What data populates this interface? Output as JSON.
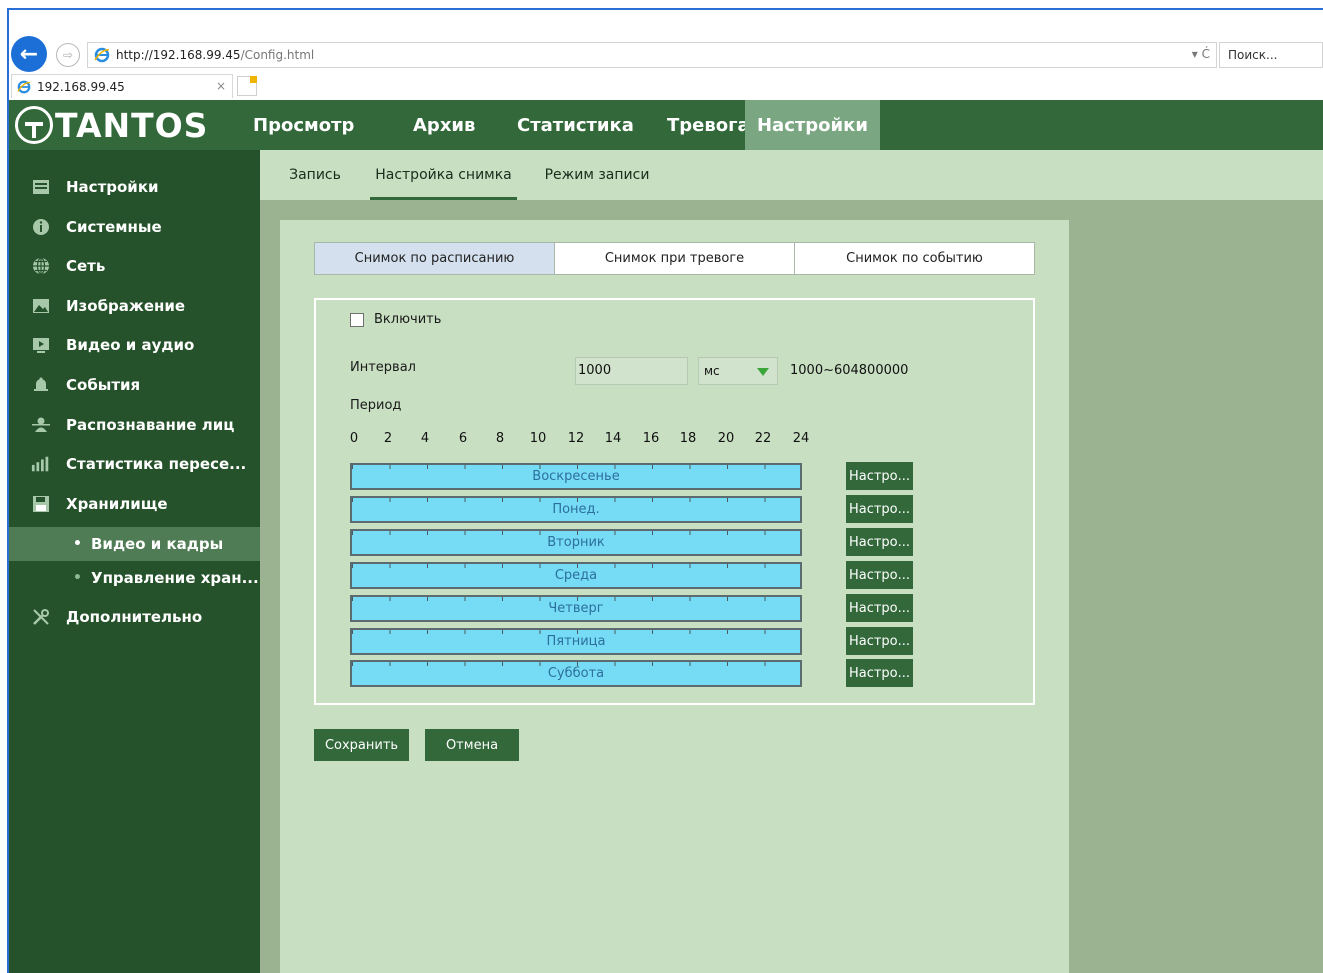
{
  "browser": {
    "address_host": "http://192.168.99.45",
    "address_path": "/Config.html",
    "address_controls": "▾ Ć",
    "search_placeholder": "Поиск...",
    "tab_title": "192.168.99.45",
    "tab_close": "×"
  },
  "app": {
    "logo_text": "TANTOS",
    "nav": [
      "Просмотр",
      "Архив",
      "Статистика",
      "Тревога",
      "Настройки"
    ],
    "nav_active": "Настройки"
  },
  "sidebar": {
    "items": [
      {
        "label": "Настройки",
        "icon": "settings-list-icon"
      },
      {
        "label": "Системные",
        "icon": "info-icon"
      },
      {
        "label": "Сеть",
        "icon": "globe-icon"
      },
      {
        "label": "Изображение",
        "icon": "image-icon"
      },
      {
        "label": "Видео и аудио",
        "icon": "video-icon"
      },
      {
        "label": "События",
        "icon": "bell-icon"
      },
      {
        "label": "Распознавание лиц",
        "icon": "face-icon"
      },
      {
        "label": "Статистика пересе...",
        "icon": "bar-chart-icon"
      },
      {
        "label": "Хранилище",
        "icon": "floppy-icon"
      }
    ],
    "subitems": [
      {
        "label": "Видео и кадры",
        "active": true
      },
      {
        "label": "Управление хран...",
        "active": false
      }
    ],
    "extra": {
      "label": "Дополнительно",
      "icon": "tools-icon"
    }
  },
  "subtabs": [
    "Запись",
    "Настройка снимка",
    "Режим записи"
  ],
  "subtab_active": "Настройка снимка",
  "segments": [
    "Снимок по расписанию",
    "Снимок при тревоге",
    "Снимок по событию"
  ],
  "segment_active": "Снимок по расписанию",
  "form": {
    "enable_label": "Включить",
    "enable_checked": false,
    "interval_label": "Интервал",
    "interval_value": "1000",
    "unit_value": "мс",
    "range_text": "1000~604800000",
    "period_label": "Период",
    "hours": [
      "0",
      "2",
      "4",
      "6",
      "8",
      "10",
      "12",
      "14",
      "16",
      "18",
      "20",
      "22",
      "24"
    ],
    "days": [
      "Воскресенье",
      "Понед.",
      "Вторник",
      "Среда",
      "Четверг",
      "Пятница",
      "Суббота"
    ],
    "config_button": "Настро...",
    "save_button": "Сохранить",
    "cancel_button": "Отмена"
  },
  "colors": {
    "brand": "#33693a",
    "sidebar": "#25522b",
    "panel": "#c8dfc2",
    "schedule_bar": "#76dcf5"
  }
}
